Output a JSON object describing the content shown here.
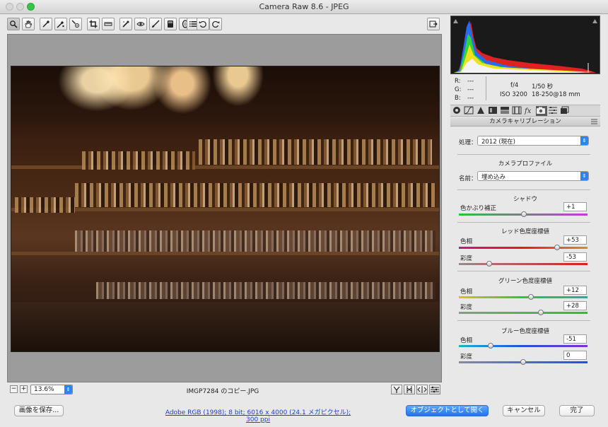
{
  "window": {
    "title": "Camera Raw 8.6  -  JPEG"
  },
  "toolbar": {
    "tools": [
      {
        "name": "zoom-tool",
        "icon": "magnifier-icon"
      },
      {
        "name": "hand-tool",
        "icon": "hand-icon"
      },
      {
        "name": "white-balance-tool",
        "icon": "eyedropper-icon"
      },
      {
        "name": "color-sampler-tool",
        "icon": "color-sampler-icon"
      },
      {
        "name": "targeted-adjustment-tool",
        "icon": "target-adjust-icon"
      },
      {
        "name": "crop-tool",
        "icon": "crop-icon"
      },
      {
        "name": "straighten-tool",
        "icon": "straighten-icon"
      },
      {
        "name": "spot-removal-tool",
        "icon": "spot-removal-icon"
      },
      {
        "name": "red-eye-tool",
        "icon": "red-eye-icon"
      },
      {
        "name": "adjustment-brush-tool",
        "icon": "brush-icon"
      },
      {
        "name": "graduated-filter-tool",
        "icon": "graduated-filter-icon"
      },
      {
        "name": "radial-filter-tool",
        "icon": "radial-filter-icon"
      },
      {
        "name": "preferences-tool",
        "icon": "list-icon"
      },
      {
        "name": "rotate-left-tool",
        "icon": "rotate-ccw-icon"
      },
      {
        "name": "rotate-right-tool",
        "icon": "rotate-cw-icon"
      }
    ]
  },
  "statusbar": {
    "zoom": "13.6%",
    "filename": "IMGP7284 のコピー.JPG"
  },
  "info": {
    "r_label": "R:",
    "r_val": "---",
    "g_label": "G:",
    "g_val": "---",
    "b_label": "B:",
    "b_val": "---",
    "aperture": "f/4",
    "shutter": "1/50 秒",
    "iso": "ISO 3200",
    "lens": "18-250@18 mm"
  },
  "panel": {
    "header": "カメラキャリブレーション",
    "process_label": "処理：",
    "process_value": "2012 (現在)",
    "profile_title": "カメラプロファイル",
    "name_label": "名前：",
    "name_value": "埋め込み",
    "shadow_title": "シャドウ",
    "shadow_tint_label": "色かぶり補正",
    "shadow_tint_value": "+1",
    "shadow_tint_pos": 0.505,
    "red_title": "レッド色度座標値",
    "red_hue_label": "色相",
    "red_hue_value": "+53",
    "red_hue_pos": 0.765,
    "red_sat_label": "彩度",
    "red_sat_value": "-53",
    "red_sat_pos": 0.235,
    "green_title": "グリーン色度座標値",
    "green_hue_label": "色相",
    "green_hue_value": "+12",
    "green_hue_pos": 0.56,
    "green_sat_label": "彩度",
    "green_sat_value": "+28",
    "green_sat_pos": 0.64,
    "blue_title": "ブルー色度座標値",
    "blue_hue_label": "色相",
    "blue_hue_value": "-51",
    "blue_hue_pos": 0.245,
    "blue_sat_label": "彩度",
    "blue_sat_value": "0",
    "blue_sat_pos": 0.5
  },
  "bottom": {
    "save_label": "画像を保存...",
    "workflow_link": "Adobe RGB (1998); 8 bit; 6016 x 4000 (24.1 メガピクセル); 300 ppi",
    "open_label": "オブジェクトとして開く",
    "cancel_label": "キャンセル",
    "done_label": "完了"
  },
  "colors": {
    "accent": "#2f83f5",
    "shadow_track": [
      "#2fbf3a",
      "#c33bd8"
    ],
    "red_hue_track": [
      "#c2187a",
      "#d81f1f",
      "#e08a20"
    ],
    "red_sat_track": [
      "#9a8a8a",
      "#d81f1f"
    ],
    "green_hue_track": [
      "#d8c020",
      "#38c038",
      "#20b0a0"
    ],
    "green_sat_track": [
      "#8a9a8a",
      "#2cc02c"
    ],
    "blue_hue_track": [
      "#20b0c8",
      "#2050e0",
      "#8030d0"
    ],
    "blue_sat_track": [
      "#8a8a9a",
      "#2050e0"
    ]
  }
}
